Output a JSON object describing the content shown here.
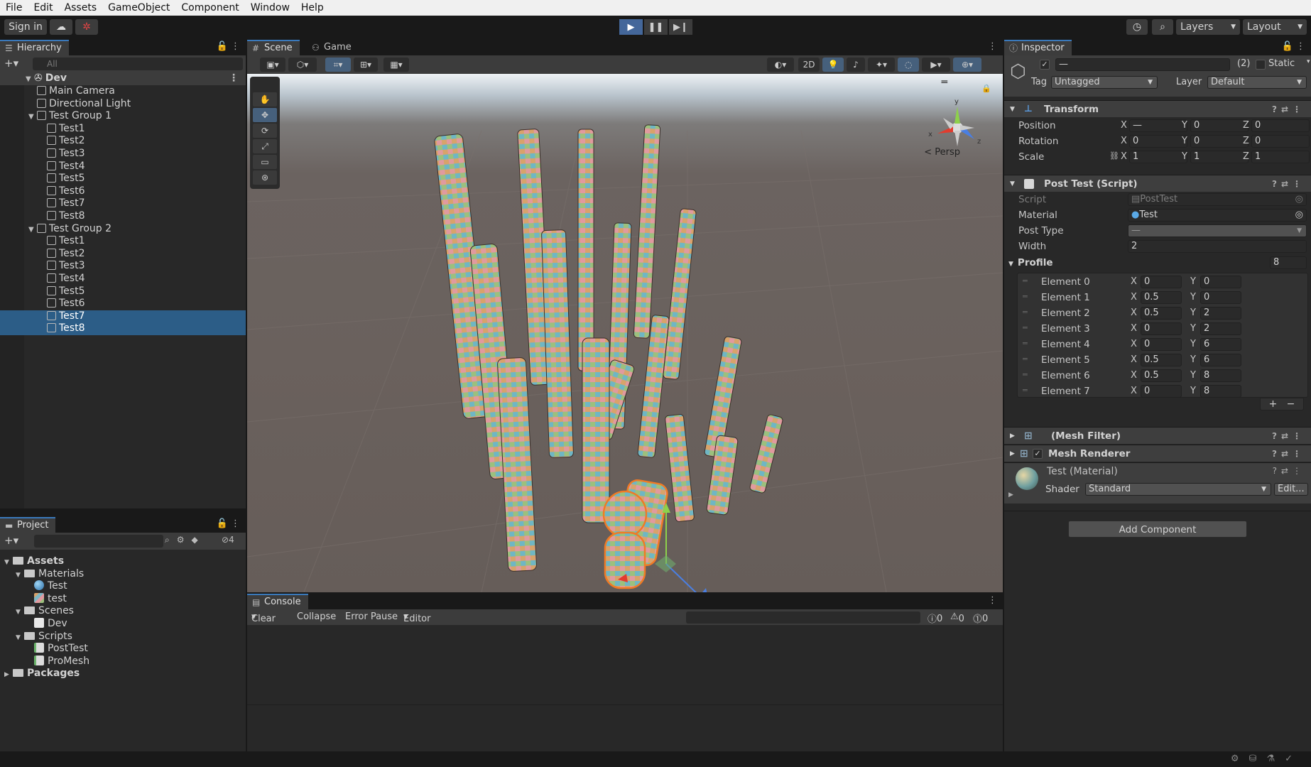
{
  "menu": [
    "File",
    "Edit",
    "Assets",
    "GameObject",
    "Component",
    "Window",
    "Help"
  ],
  "toolbar": {
    "sign_in": "Sign in",
    "layers": "Layers",
    "layout": "Layout"
  },
  "hierarchy": {
    "tab": "Hierarchy",
    "search_placeholder": "All",
    "scene": "Dev",
    "items": [
      {
        "label": "Main Camera",
        "depth": 1
      },
      {
        "label": "Directional Light",
        "depth": 1
      },
      {
        "label": "Test Group 1",
        "depth": 1,
        "group": true
      },
      {
        "label": "Test1",
        "depth": 2
      },
      {
        "label": "Test2",
        "depth": 2
      },
      {
        "label": "Test3",
        "depth": 2
      },
      {
        "label": "Test4",
        "depth": 2
      },
      {
        "label": "Test5",
        "depth": 2
      },
      {
        "label": "Test6",
        "depth": 2
      },
      {
        "label": "Test7",
        "depth": 2
      },
      {
        "label": "Test8",
        "depth": 2
      },
      {
        "label": "Test Group 2",
        "depth": 1,
        "group": true
      },
      {
        "label": "Test1",
        "depth": 2
      },
      {
        "label": "Test2",
        "depth": 2
      },
      {
        "label": "Test3",
        "depth": 2
      },
      {
        "label": "Test4",
        "depth": 2
      },
      {
        "label": "Test5",
        "depth": 2
      },
      {
        "label": "Test6",
        "depth": 2
      },
      {
        "label": "Test7",
        "depth": 2,
        "selected": true
      },
      {
        "label": "Test8",
        "depth": 2,
        "selected": true
      }
    ]
  },
  "project": {
    "tab": "Project",
    "hidden_count": "4",
    "tree": [
      {
        "label": "Assets",
        "depth": 0,
        "type": "folder",
        "bold": true
      },
      {
        "label": "Materials",
        "depth": 1,
        "type": "folder"
      },
      {
        "label": "Test",
        "depth": 2,
        "type": "material"
      },
      {
        "label": "test",
        "depth": 2,
        "type": "texture"
      },
      {
        "label": "Scenes",
        "depth": 1,
        "type": "folder"
      },
      {
        "label": "Dev",
        "depth": 2,
        "type": "scene"
      },
      {
        "label": "Scripts",
        "depth": 1,
        "type": "folder"
      },
      {
        "label": "PostTest",
        "depth": 2,
        "type": "script"
      },
      {
        "label": "ProMesh",
        "depth": 2,
        "type": "script"
      },
      {
        "label": "Packages",
        "depth": 0,
        "type": "folder",
        "bold": true
      }
    ]
  },
  "scene": {
    "tab_scene": "Scene",
    "tab_game": "Game",
    "mode_2d": "2D",
    "persp": "Persp",
    "gizmo_x": "x",
    "gizmo_y": "y",
    "gizmo_z": "z"
  },
  "console": {
    "tab": "Console",
    "clear": "Clear",
    "collapse": "Collapse",
    "error_pause": "Error Pause",
    "editor": "Editor",
    "count_log": "0",
    "count_warn": "0",
    "count_err": "0"
  },
  "inspector": {
    "tab": "Inspector",
    "name_value": "—",
    "count": "(2)",
    "static": "Static",
    "tag_label": "Tag",
    "tag_value": "Untagged",
    "layer_label": "Layer",
    "layer_value": "Default",
    "transform": {
      "title": "Transform",
      "rows": [
        {
          "label": "Position",
          "x": "—",
          "y": "0",
          "z": "0"
        },
        {
          "label": "Rotation",
          "x": "0",
          "y": "0",
          "z": "0"
        },
        {
          "label": "Scale",
          "x": "1",
          "y": "1",
          "z": "1"
        }
      ]
    },
    "post_test": {
      "title": "Post Test (Script)",
      "script_label": "Script",
      "script_value": "PostTest",
      "material_label": "Material",
      "material_value": "Test",
      "post_type_label": "Post Type",
      "post_type_value": "—",
      "width_label": "Width",
      "width_value": "2",
      "profile_label": "Profile",
      "profile_count": "8",
      "elements": [
        {
          "label": "Element 0",
          "x": "0",
          "y": "0"
        },
        {
          "label": "Element 1",
          "x": "0.5",
          "y": "0"
        },
        {
          "label": "Element 2",
          "x": "0.5",
          "y": "2"
        },
        {
          "label": "Element 3",
          "x": "0",
          "y": "2"
        },
        {
          "label": "Element 4",
          "x": "0",
          "y": "6"
        },
        {
          "label": "Element 5",
          "x": "0.5",
          "y": "6"
        },
        {
          "label": "Element 6",
          "x": "0.5",
          "y": "8"
        },
        {
          "label": "Element 7",
          "x": "0",
          "y": "8"
        }
      ]
    },
    "mesh_filter": "(Mesh Filter)",
    "mesh_renderer": "Mesh Renderer",
    "material_name": "Test (Material)",
    "shader_label": "Shader",
    "shader_value": "Standard",
    "edit_button": "Edit...",
    "add_component": "Add Component"
  }
}
